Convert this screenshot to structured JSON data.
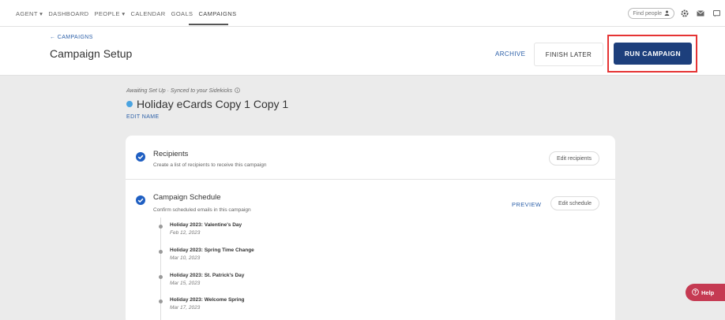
{
  "nav": {
    "items": [
      {
        "label": "AGENT ▾",
        "active": false
      },
      {
        "label": "DASHBOARD",
        "active": false
      },
      {
        "label": "PEOPLE ▾",
        "active": false
      },
      {
        "label": "CALENDAR",
        "active": false
      },
      {
        "label": "GOALS",
        "active": false
      },
      {
        "label": "CAMPAIGNS",
        "active": true
      }
    ],
    "find_people": "Find people",
    "icons": [
      "person-icon",
      "gear-icon",
      "mail-icon",
      "chat-icon"
    ]
  },
  "header": {
    "back_link": "← CAMPAIGNS",
    "title": "Campaign Setup",
    "archive": "ARCHIVE",
    "finish_later": "FINISH LATER",
    "run_campaign": "RUN CAMPAIGN"
  },
  "campaign": {
    "status": "Awaiting Set Up · Synced to your Sidekicks",
    "name": "Holiday eCards Copy 1 Copy 1",
    "edit_name": "EDIT NAME"
  },
  "recipients": {
    "title": "Recipients",
    "subtitle": "Create a list of recipients to receive this campaign",
    "button": "Edit recipients"
  },
  "schedule": {
    "title": "Campaign Schedule",
    "subtitle": "Confirm scheduled emails in this campaign",
    "preview": "PREVIEW",
    "button": "Edit schedule",
    "events": [
      {
        "title": "Holiday 2023: Valentine's Day",
        "date": "Feb 12, 2023"
      },
      {
        "title": "Holiday 2023: Spring Time Change",
        "date": "Mar 10, 2023"
      },
      {
        "title": "Holiday 2023: St. Patrick's Day",
        "date": "Mar 15, 2023"
      },
      {
        "title": "Holiday 2023: Welcome Spring",
        "date": "Mar 17, 2023"
      }
    ]
  },
  "help": {
    "label": "Help"
  },
  "colors": {
    "primary": "#1d3f7c",
    "link": "#2b5fa8",
    "highlight": "#e53434",
    "help": "#c53a52"
  }
}
